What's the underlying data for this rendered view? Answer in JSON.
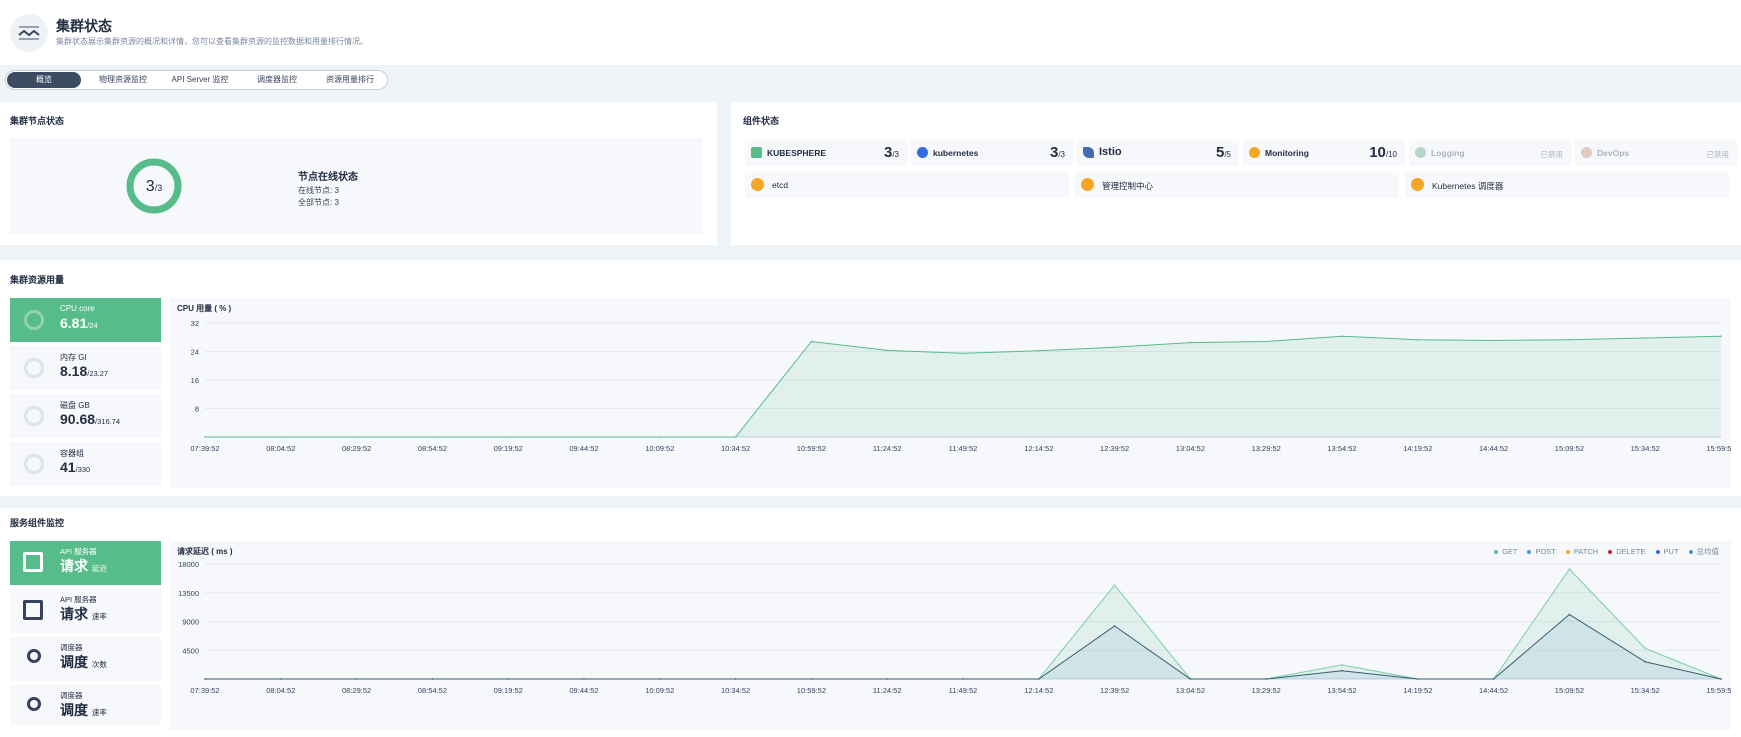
{
  "header": {
    "title": "集群状态",
    "description": "集群状态展示集群资源的概况和详情，您可以查看集群资源的监控数据和用量排行情况。"
  },
  "tabs": [
    "概览",
    "物理资源监控",
    "API Server 监控",
    "调度器监控",
    "资源用量排行"
  ],
  "nodes": {
    "title": "集群节点状态",
    "ring_value": "3",
    "ring_total": "/3",
    "status_title": "节点在线状态",
    "online": "在线节点: 3",
    "total": "全部节点: 3"
  },
  "components": {
    "title": "组件状态",
    "items": [
      {
        "name": "KUBESPHERE",
        "value": "3",
        "total": "/3",
        "icon": "kubesphere-icon",
        "color": "#55bc8a"
      },
      {
        "name": "kubernetes",
        "value": "3",
        "total": "/3",
        "icon": "kubernetes-icon",
        "color": "#326ce5"
      },
      {
        "name": "Istio",
        "value": "5",
        "total": "/5",
        "icon": "istio-icon",
        "color": "#466bb0"
      },
      {
        "name": "Monitoring",
        "value": "10",
        "total": "/10",
        "icon": "monitoring-icon",
        "color": "#f5a623"
      },
      {
        "name": "Logging",
        "disabled": "已禁用",
        "icon": "logging-icon",
        "color": "#b7d6c8"
      },
      {
        "name": "DevOps",
        "disabled": "已禁用",
        "icon": "devops-icon",
        "color": "#e0c9c0"
      }
    ],
    "extra": [
      "etcd",
      "管理控制中心",
      "Kubernetes 调度器"
    ]
  },
  "resource": {
    "title": "集群资源用量",
    "items": [
      {
        "label": "CPU core",
        "value": "6.81",
        "total": "/24",
        "fraction": 0.284
      },
      {
        "label": "内存 GI",
        "value": "8.18",
        "total": "/23.27",
        "fraction": 0.352
      },
      {
        "label": "磁盘 GB",
        "value": "90.68",
        "total": "/316.74",
        "fraction": 0.286
      },
      {
        "label": "容器组",
        "value": "41",
        "total": "/330",
        "fraction": 0.124
      }
    ]
  },
  "service": {
    "title": "服务组件监控",
    "items": [
      {
        "label": "API 服务器",
        "main": "请求",
        "sub": "延迟"
      },
      {
        "label": "API 服务器",
        "main": "请求",
        "sub": "速率"
      },
      {
        "label": "调度器",
        "main": "调度",
        "sub": "次数"
      },
      {
        "label": "调度器",
        "main": "调度",
        "sub": "速率"
      }
    ],
    "legend": [
      {
        "name": "GET",
        "color": "#55bc8a"
      },
      {
        "name": "POST",
        "color": "#3d9ae0"
      },
      {
        "name": "PATCH",
        "color": "#f5a623"
      },
      {
        "name": "DELETE",
        "color": "#ca2621"
      },
      {
        "name": "PUT",
        "color": "#326ce5"
      },
      {
        "name": "总均值",
        "color": "#4a90c8"
      }
    ]
  },
  "chart_data": [
    {
      "type": "area",
      "title": "CPU 用量 ( % )",
      "ylim": [
        0,
        32
      ],
      "yticks": [
        "32",
        "24",
        "16",
        "8"
      ],
      "x": [
        "07:39:52",
        "08:04:52",
        "08:29:52",
        "08:54:52",
        "09:19:52",
        "09:44:52",
        "10:09:52",
        "10:34:52",
        "10:59:52",
        "11:24:52",
        "11:49:52",
        "12:14:52",
        "12:39:52",
        "13:04:52",
        "13:29:52",
        "13:54:52",
        "14:19:52",
        "14:44:52",
        "15:09:52",
        "15:34:52",
        "15:59:52"
      ],
      "series": [
        {
          "values": [
            0,
            0,
            0,
            0,
            0,
            0,
            0,
            0,
            26.8,
            24.3,
            23.5,
            24.2,
            25.2,
            26.5,
            26.8,
            28.3,
            27.3,
            27.1,
            27.3,
            27.8,
            28.3
          ]
        }
      ]
    },
    {
      "type": "area",
      "title": "请求延迟 ( ms )",
      "ylim": [
        0,
        18000
      ],
      "yticks": [
        "18000",
        "13500",
        "9000",
        "4500"
      ],
      "x": [
        "07:39:52",
        "08:04:52",
        "08:29:52",
        "08:54:52",
        "09:19:52",
        "09:44:52",
        "10:09:52",
        "10:34:52",
        "10:59:52",
        "11:24:52",
        "11:49:52",
        "12:14:52",
        "12:39:52",
        "13:04:52",
        "13:29:52",
        "13:54:52",
        "14:19:52",
        "14:44:52",
        "15:09:52",
        "15:34:52",
        "15:59:52"
      ],
      "series": [
        {
          "values": [
            0,
            0,
            0,
            0,
            0,
            0,
            0,
            0,
            0,
            0,
            0,
            0,
            14700,
            0,
            0,
            2200,
            0,
            0,
            17200,
            4800,
            0
          ]
        },
        {
          "values": [
            0,
            0,
            0,
            0,
            0,
            0,
            0,
            0,
            0,
            0,
            0,
            0,
            8300,
            0,
            0,
            1300,
            0,
            0,
            10100,
            2700,
            0
          ]
        }
      ]
    }
  ]
}
